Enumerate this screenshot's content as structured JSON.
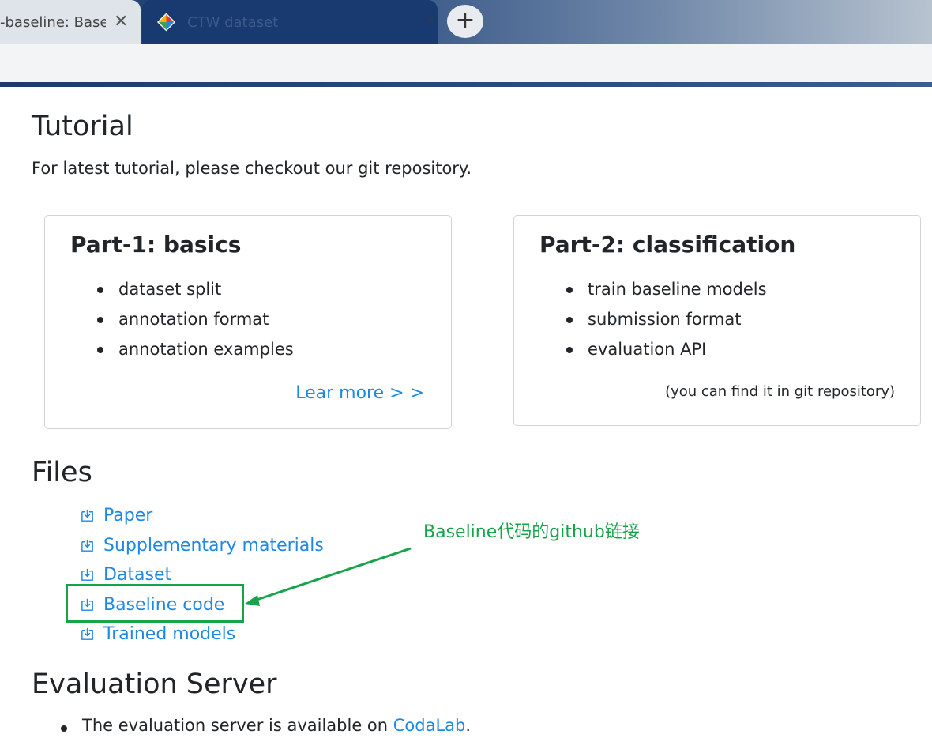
{
  "browser": {
    "tabs": [
      {
        "title": "-baseline: Base",
        "active": false
      },
      {
        "title": "CTW dataset",
        "active": true
      }
    ],
    "close_glyph": "✕",
    "new_tab_glyph": "+"
  },
  "tutorial": {
    "title": "Tutorial",
    "description": "For latest tutorial, please checkout our git repository.",
    "cards": [
      {
        "title": "Part-1: basics",
        "items": [
          "dataset split",
          "annotation format",
          "annotation examples"
        ],
        "link": "Lear more > >"
      },
      {
        "title": "Part-2: classification",
        "items": [
          "train baseline models",
          "submission format",
          "evaluation API"
        ],
        "note": "(you can find it in git repository)"
      }
    ]
  },
  "files": {
    "title": "Files",
    "items": [
      "Paper",
      "Supplementary materials",
      "Dataset",
      "Baseline code",
      "Trained models"
    ],
    "icon": "download-icon"
  },
  "annotation": {
    "text": "Baseline代码的github链接",
    "color": "#17a349"
  },
  "evaluation": {
    "title": "Evaluation Server",
    "text_before": "The evaluation server is available on ",
    "link": "CodaLab",
    "text_after": "."
  },
  "colors": {
    "link": "#1e88e5",
    "text": "#212529",
    "annotation": "#17a349"
  }
}
